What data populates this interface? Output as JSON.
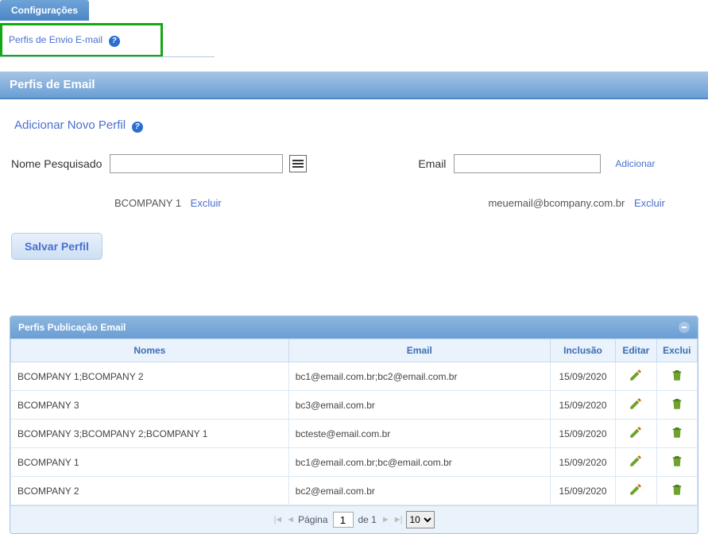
{
  "tabs": {
    "config": "Configurações"
  },
  "nav": {
    "perfis_envio": "Perfis de Envio E-mail"
  },
  "panel": {
    "title": "Perfis de Email"
  },
  "form": {
    "add_profile": "Adicionar Novo Perfil",
    "nome_label": "Nome Pesquisado",
    "email_label": "Email",
    "adicionar": "Adicionar",
    "nome_entry": "BCOMPANY 1",
    "email_entry": "meuemail@bcompany.com.br",
    "excluir": "Excluir",
    "salvar": "Salvar Perfil"
  },
  "grid": {
    "title": "Perfis Publicação Email",
    "headers": {
      "nomes": "Nomes",
      "email": "Email",
      "inclusao": "Inclusão",
      "editar": "Editar",
      "excluir": "Exclui"
    },
    "rows": [
      {
        "nomes": "BCOMPANY 1;BCOMPANY 2",
        "email": "bc1@email.com.br;bc2@email.com.br",
        "inclusao": "15/09/2020"
      },
      {
        "nomes": "BCOMPANY 3",
        "email": "bc3@email.com.br",
        "inclusao": "15/09/2020"
      },
      {
        "nomes": "BCOMPANY 3;BCOMPANY 2;BCOMPANY 1",
        "email": "bcteste@email.com.br",
        "inclusao": "15/09/2020"
      },
      {
        "nomes": "BCOMPANY 1",
        "email": "bc1@email.com.br;bc@email.com.br",
        "inclusao": "15/09/2020"
      },
      {
        "nomes": "BCOMPANY 2",
        "email": "bc2@email.com.br",
        "inclusao": "15/09/2020"
      }
    ]
  },
  "pager": {
    "pagina": "Página",
    "de": "de 1",
    "page_value": "1",
    "page_size": "10"
  }
}
